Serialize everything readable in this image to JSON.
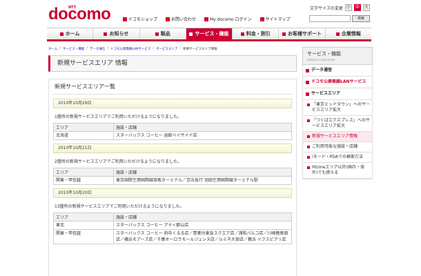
{
  "header": {
    "logo_sub": "NTT",
    "logo_text": "docomo",
    "fontsize": {
      "label": "文字サイズの変更",
      "options": [
        "小",
        "中",
        "大"
      ],
      "active": 1
    },
    "utility_links": [
      "ドコモショップ",
      "お問い合わせ",
      "My docomo ログイン",
      "サイトマップ"
    ],
    "search": {
      "placeholder": "",
      "button": "検索"
    }
  },
  "nav": {
    "items": [
      "ホーム",
      "お知らせ",
      "製品",
      "サービス・機能",
      "料金・割引",
      "お客様サポート",
      "企業情報"
    ],
    "active": 3
  },
  "breadcrumb": [
    "ホーム",
    "サービス・機能",
    "データ通信",
    "ドコモ公衆無線LANサービス",
    "サービスエリア",
    "新規サービスエリア情報"
  ],
  "page_title": "新規サービスエリア 情報",
  "main": {
    "section_title": "新規サービスエリア一覧",
    "col_area": "エリア",
    "col_facility": "施設・店舗",
    "blocks": [
      {
        "date": "2010年10月29日",
        "notice": "1箇所の新規サービスエリアでご利用いただけるようになりました。",
        "rows": [
          {
            "area": "北海道",
            "facility": "スターバックス コーヒー 函館ベイサイド店"
          }
        ]
      },
      {
        "date": "2010年10月21日",
        "notice": "2箇所の新規サービスエリアでご利用いただけるようになりました。",
        "rows": [
          {
            "area": "関東・甲信越",
            "facility": "東京国際空港国際線旅客ターミナル／京浜急行 羽田空港国際線ターミナル駅"
          }
        ]
      },
      {
        "date": "2010年10月20日",
        "notice": "13箇所の新規サービスエリアでご利用いただけるようになりました。",
        "rows": [
          {
            "area": "東北",
            "facility": "スターバックス コーヒー アティ郡山店"
          },
          {
            "area": "関東・甲信越",
            "facility": "スターバックス コーヒー 府中くるる店／青葉台東急スクエア店／浦和パルコ店／川崎鹿島田店／横浜モアーズ店／千葉オーロラモールジュンヌ店／ルミネ大宮店／舞浜 イクスピアリ店"
          }
        ]
      }
    ]
  },
  "sidebar": {
    "title": "サービス・機能",
    "subtitle": "SERVICE & FUNCTIONS",
    "items": [
      "データ通信",
      "ドコモ公衆無線LANサービス",
      "サービスエリア"
    ],
    "sublinks": [
      "「東京ミッドタウン」へのサービスエリア拡大",
      "「つくばエクスプレス」へのサービスエリア拡大",
      "新規サービスエリア情報",
      "ご利用可能な施設・店舗",
      "iモード・PDAでの検索方法",
      "Mzoneエリア以外(国内・海外)でも使える"
    ]
  }
}
